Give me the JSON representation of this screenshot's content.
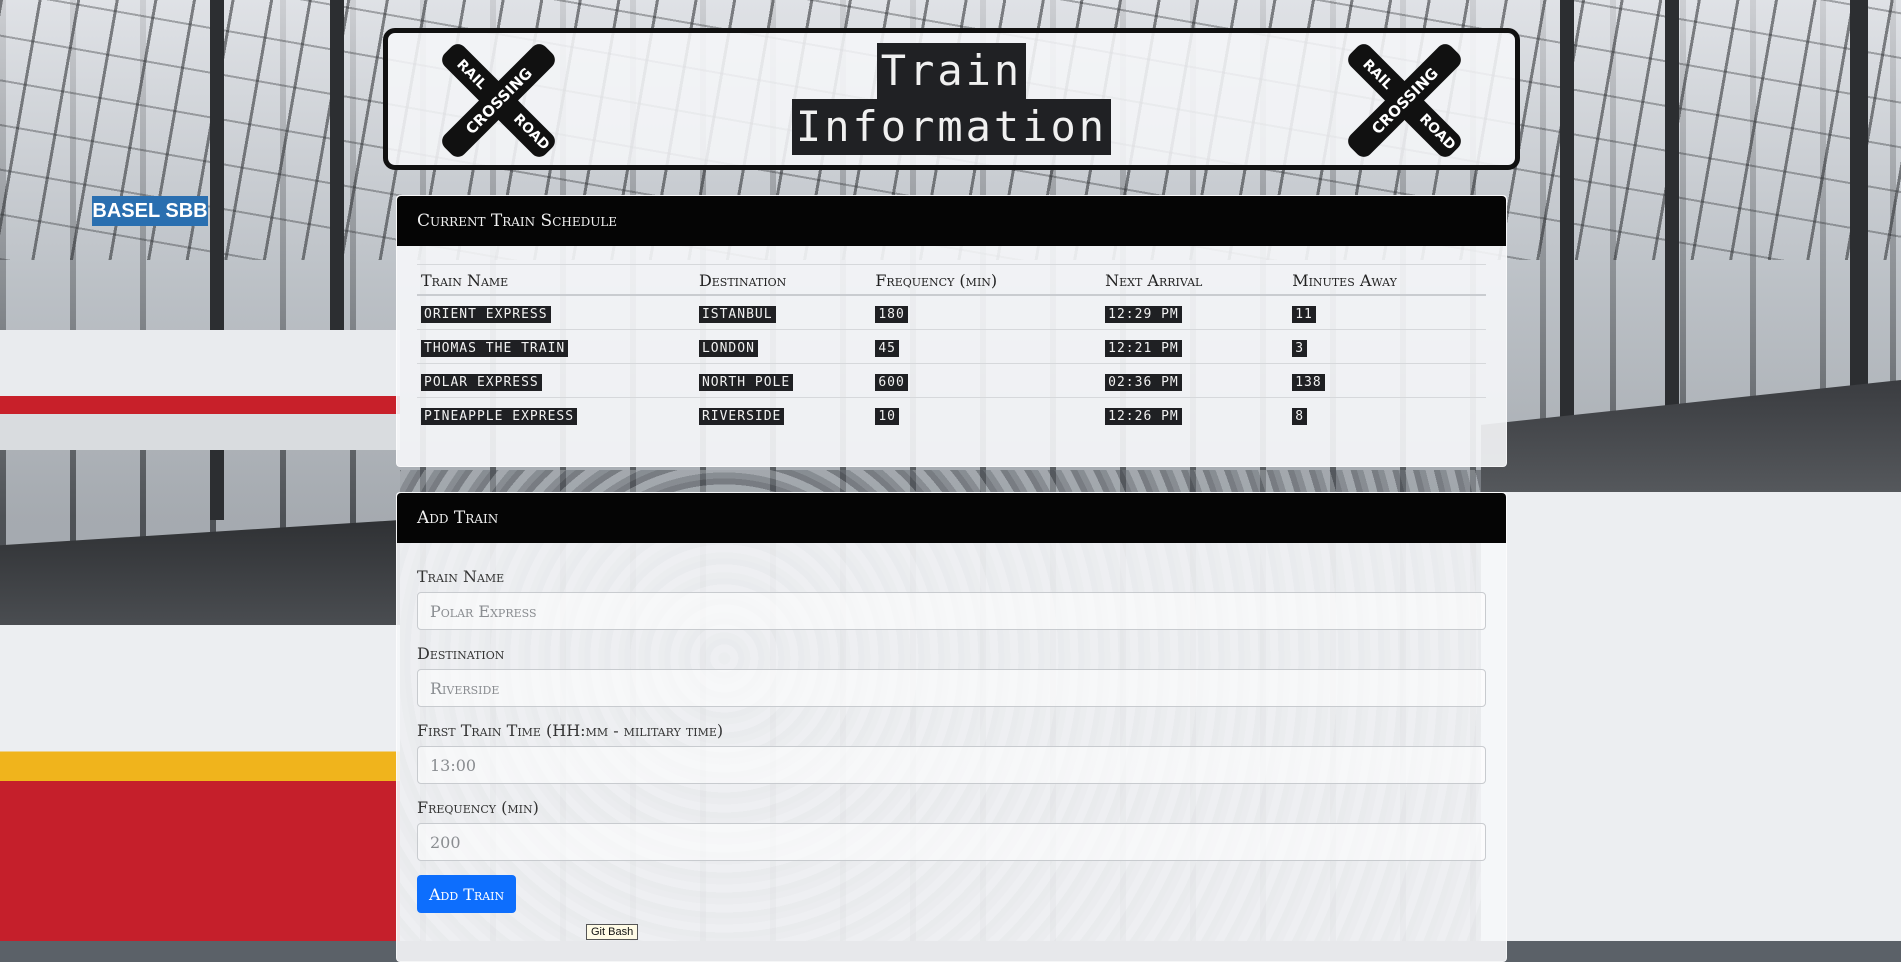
{
  "header": {
    "title_line1": "Train",
    "title_line2": "Information",
    "sign_text_top": "RAIL",
    "sign_text_mid": "CROSSING",
    "sign_text_bottom": "ROAD"
  },
  "background": {
    "station_sign": "BASEL SBB"
  },
  "schedule": {
    "heading": "Current Train Schedule",
    "columns": [
      "Train Name",
      "Destination",
      "Frequency (min)",
      "Next Arrival",
      "Minutes Away"
    ],
    "rows": [
      [
        "ORIENT EXPRESS",
        "ISTANBUL",
        "180",
        "12:29 PM",
        "11"
      ],
      [
        "THOMAS THE TRAIN",
        "LONDON",
        "45",
        "12:21 PM",
        "3"
      ],
      [
        "POLAR EXPRESS",
        "NORTH POLE",
        "600",
        "02:36 PM",
        "138"
      ],
      [
        "PINEAPPLE EXPRESS",
        "RIVERSIDE",
        "10",
        "12:26 PM",
        "8"
      ]
    ]
  },
  "add_train": {
    "heading": "Add Train",
    "train_name_label": "Train Name",
    "train_name_placeholder": "Polar Express",
    "destination_label": "Destination",
    "destination_placeholder": "Riverside",
    "first_time_label": "First Train Time (HH:mm - military time)",
    "first_time_placeholder": "13:00",
    "frequency_label": "Frequency (min)",
    "frequency_placeholder": "200",
    "submit_label": "Add Train"
  },
  "tooltip": {
    "text": "Git Bash"
  },
  "colors": {
    "panel_heading_bg": "#050505",
    "button_bg": "#0d6efd",
    "cell_bg": "#1f2023"
  }
}
